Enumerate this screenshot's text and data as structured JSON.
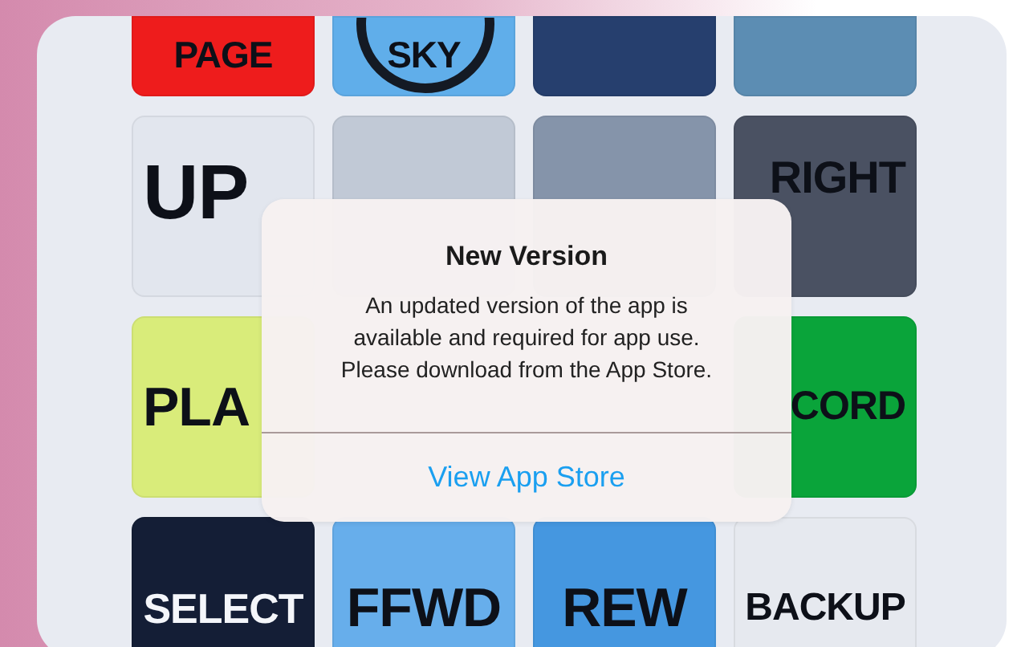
{
  "remote": {
    "rows": [
      [
        {
          "kind": "plain",
          "label": "PAGE",
          "color": "#ee1c1c"
        },
        {
          "kind": "ring",
          "label": "SKY",
          "color": "#60aeea"
        },
        {
          "kind": "plain",
          "color": "#263f6e"
        },
        {
          "kind": "plain",
          "color": "#5c8db3"
        }
      ],
      [
        {
          "kind": "plain",
          "label": "UP",
          "color": "#e2e6ee"
        },
        {
          "kind": "plain",
          "color": "#c1c9d6"
        },
        {
          "kind": "plain",
          "color": "#8594aa"
        },
        {
          "kind": "plain",
          "label": "RIGHT",
          "color": "#4a5162"
        }
      ],
      [
        {
          "kind": "plain",
          "label": "PLA",
          "color": "#d9ec7a"
        },
        {
          "kind": "hidden"
        },
        {
          "kind": "hidden"
        },
        {
          "kind": "plain",
          "label": "CORD",
          "color": "#0aa43a"
        }
      ],
      [
        {
          "kind": "plain",
          "label": "SELECT",
          "color": "#141e36"
        },
        {
          "kind": "plain",
          "label": "FFWD",
          "color": "#67aeeb"
        },
        {
          "kind": "plain",
          "label": "REW",
          "color": "#4597e0"
        },
        {
          "kind": "plain",
          "label": "BACKUP",
          "color": "#e6e9ef"
        }
      ]
    ]
  },
  "alert": {
    "title": "New Version",
    "message_lines": [
      "An updated version of the app is",
      "available and required for app use.",
      "Please download from the App Store."
    ],
    "button": "View App Store"
  }
}
